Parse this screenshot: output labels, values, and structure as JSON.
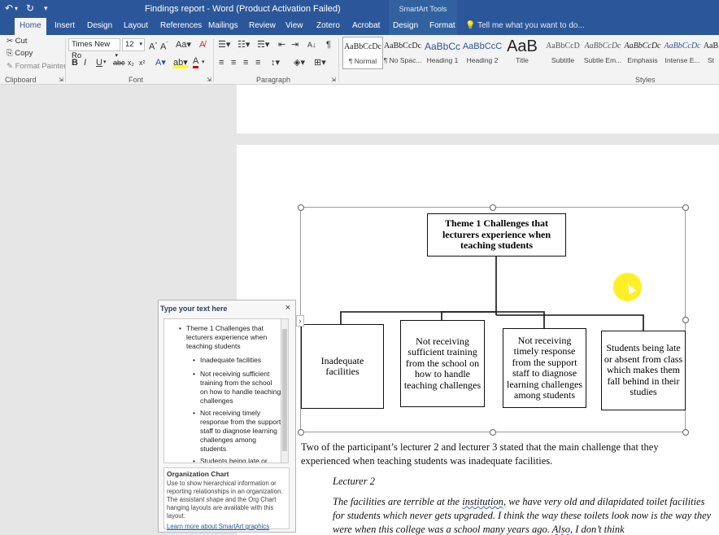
{
  "titlebar": {
    "title": "Findings report - Word (Product Activation Failed)",
    "contextual_tools": "SmartArt Tools"
  },
  "tabs": [
    "Home",
    "Insert",
    "Design",
    "Layout",
    "References",
    "Mailings",
    "Review",
    "View",
    "Zotero",
    "Acrobat",
    "Design",
    "Format"
  ],
  "tell_me": "Tell me what you want to do...",
  "clipboard": {
    "cut": "Cut",
    "copy": "Copy",
    "format_painter": "Format Painter",
    "label": "Clipboard"
  },
  "font": {
    "name": "Times New Ro",
    "size": "12",
    "label": "Font"
  },
  "paragraph": {
    "label": "Paragraph"
  },
  "styles": {
    "label": "Styles",
    "items": [
      {
        "sample": "AaBbCcDc",
        "name": "¶ Normal"
      },
      {
        "sample": "AaBbCcDc",
        "name": "¶ No Spac..."
      },
      {
        "sample": "AaBbCc",
        "name": "Heading 1"
      },
      {
        "sample": "AaBbCcC",
        "name": "Heading 2"
      },
      {
        "sample": "AaB",
        "name": "Title"
      },
      {
        "sample": "AaBbCcD",
        "name": "Subtitle"
      },
      {
        "sample": "AaBbCcDc",
        "name": "Subtle Em..."
      },
      {
        "sample": "AaBbCcDc",
        "name": "Emphasis"
      },
      {
        "sample": "AaBbCcDc",
        "name": "Intense E..."
      },
      {
        "sample": "AaB",
        "name": "St"
      }
    ]
  },
  "smartart": {
    "root": "Theme 1 Challenges that lecturers experience when teaching students",
    "children": [
      "Inadequate facilities",
      "Not receiving sufficient training from the school on how to handle teaching challenges",
      "Not receiving timely response from the support staff to diagnose learning challenges among students",
      "Students being late or absent from class which makes them fall behind in their studies"
    ]
  },
  "text_pane": {
    "header": "Type your text here",
    "close": "×",
    "items": [
      "Theme 1 Challenges that lecturers experience when teaching students",
      "Inadequate facilities",
      "Not receiving sufficient training from the school on how to handle teaching challenges",
      "Not receiving timely response from the support staff to diagnose learning challenges among students",
      "Students being late or"
    ],
    "desc_title": "Organization Chart",
    "desc_body": "Use to show hierarchical information or reporting relationships in an organization. The assistant shape and the Org Chart hanging layouts are available with this layout.",
    "desc_link": "Learn more about SmartArt graphics"
  },
  "body": {
    "para1": "Two of the participant’s lecturer 2 and lecturer 3 stated that the main challenge that they experienced when teaching students was inadequate facilities.",
    "quote_label": "Lecturer 2",
    "quote_pre": "The facilities are terrible at the ",
    "quote_word1": "institution,",
    "quote_mid": " we have very old and dilapidated toilet facilities for students which never gets upgraded. I think the way these toilets look now is the way they were when this college was a school many years ago. ",
    "quote_word2": "Also,",
    "quote_end": " I don’t think"
  }
}
